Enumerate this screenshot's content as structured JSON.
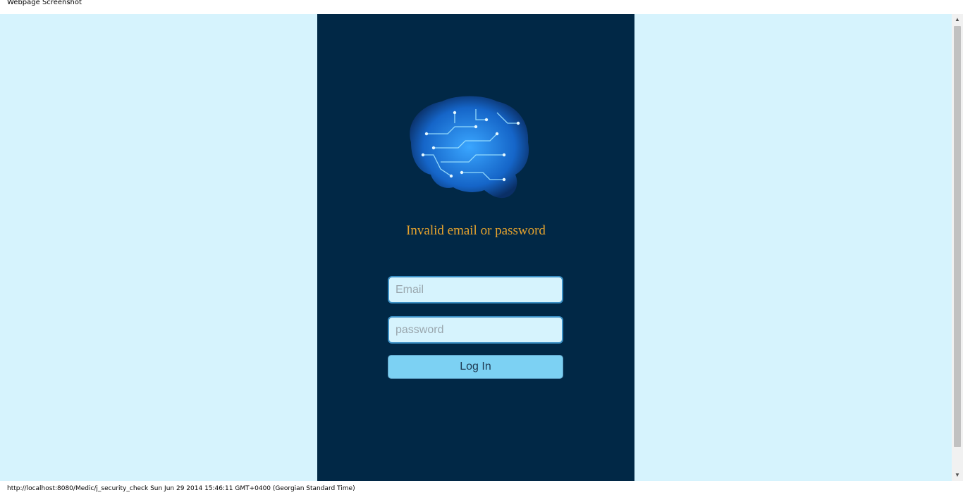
{
  "window": {
    "title": "Webpage Screenshot"
  },
  "login": {
    "error_message": "Invalid email or password",
    "email_placeholder": "Email",
    "password_placeholder": "password",
    "login_label": "Log In",
    "logo_icon": "circuit-brain-icon"
  },
  "status": {
    "text": "http://localhost:8080/Medic/j_security_check Sun Jun 29 2014 15:46:11 GMT+0400 (Georgian Standard Time)"
  },
  "colors": {
    "background": "#d6f3fd",
    "panel": "#012846",
    "error": "#e6a32e",
    "button": "#7cd1f3",
    "field_border": "#3b8fc4"
  }
}
